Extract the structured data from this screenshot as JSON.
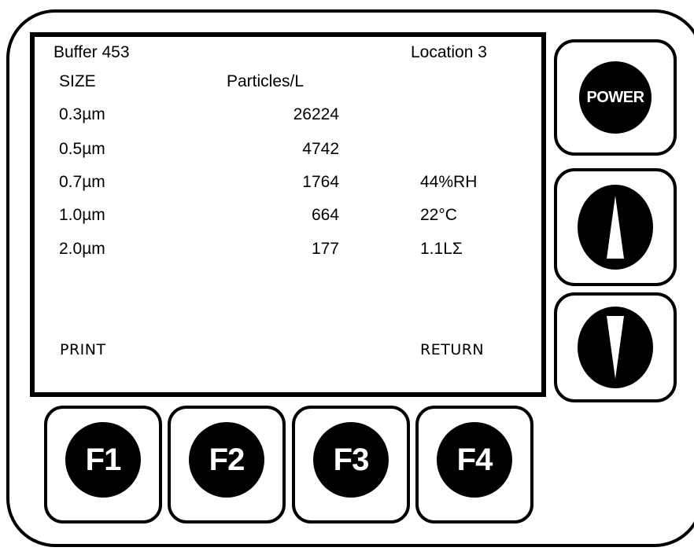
{
  "screen": {
    "buffer": "Buffer 453",
    "location": "Location 3",
    "size_header": "SIZE",
    "particles_header": "Particles/L",
    "rows": [
      {
        "size": "0.3µm",
        "count": "26224",
        "extra": ""
      },
      {
        "size": "0.5µm",
        "count": "4742",
        "extra": ""
      },
      {
        "size": "0.7µm",
        "count": "1764",
        "extra": "44%RH"
      },
      {
        "size": "1.0µm",
        "count": "664",
        "extra": "22°C"
      },
      {
        "size": "2.0µm",
        "count": "177",
        "extra": "1.1LΣ"
      }
    ],
    "softkey_left": "PRINT",
    "softkey_right": "RETURN"
  },
  "keys": {
    "power_label": "POWER",
    "up_icon": "up-arrow-icon",
    "down_icon": "down-arrow-icon",
    "f1": "F1",
    "f2": "F2",
    "f3": "F3",
    "f4": "F4"
  }
}
